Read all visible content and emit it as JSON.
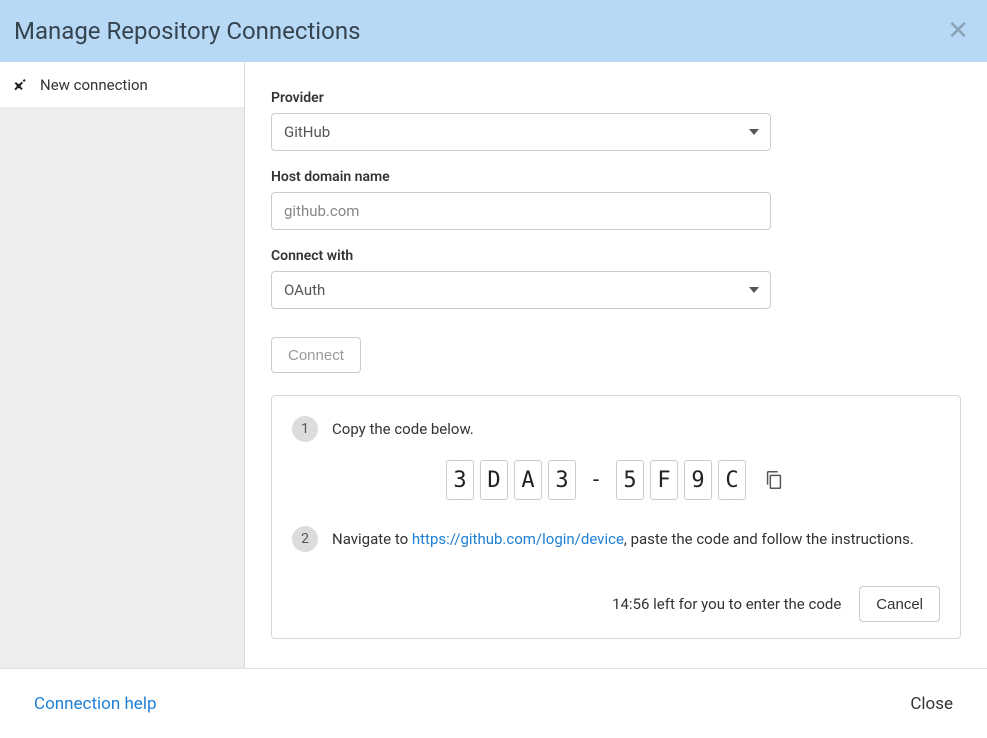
{
  "titlebar": {
    "title": "Manage Repository Connections"
  },
  "sidebar": {
    "items": [
      {
        "label": "New connection",
        "icon": "plug-icon"
      }
    ]
  },
  "form": {
    "provider": {
      "label": "Provider",
      "value": "GitHub"
    },
    "host": {
      "label": "Host domain name",
      "value": "github.com"
    },
    "connect_with": {
      "label": "Connect with",
      "value": "OAuth"
    },
    "connect_button": "Connect"
  },
  "instructions": {
    "step1_badge": "1",
    "step1_text": "Copy the code below.",
    "code_chars": [
      "3",
      "D",
      "A",
      "3",
      "-",
      "5",
      "F",
      "9",
      "C"
    ],
    "step2_badge": "2",
    "step2_prefix": "Navigate to ",
    "step2_link_text": "https://github.com/login/device",
    "step2_suffix": ", paste the code and follow the instructions.",
    "timer_text": "14:56 left for you to enter the code",
    "cancel_button": "Cancel"
  },
  "footer": {
    "help_link": "Connection help",
    "close_button": "Close"
  }
}
